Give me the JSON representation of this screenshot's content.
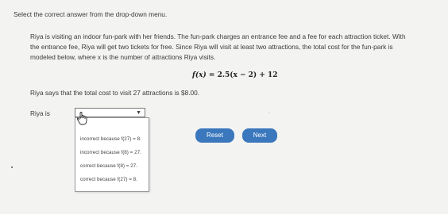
{
  "instruction": "Select the correct answer from the drop-down menu.",
  "problem": {
    "line1": "Riya is visiting an indoor fun-park with her friends. The fun-park charges an entrance fee and a fee for each attraction ticket. With",
    "line2": "the entrance fee, Riya will get two tickets for free. Since Riya will visit at least two attractions, the total cost for the fun-park is",
    "line3": "modeled below, where x is the number of attractions Riya visits."
  },
  "formula": {
    "lhs": "f(x)",
    "eq": " = ",
    "rhs": "2.5(x − 2) + 12"
  },
  "statement": "Riya says that the total cost to visit 27 attractions is $8.00.",
  "answer": {
    "prefix": "Riya is",
    "selected": "",
    "options": [
      "incorrect because f(27) = 8.",
      "incorrect because f(8) = 27.",
      "correct because f(8) = 27.",
      "correct because f(27) = 8."
    ]
  },
  "buttons": {
    "reset": "Reset",
    "next": "Next"
  },
  "colors": {
    "button": "#3a77bd",
    "background": "#f3f3f1"
  }
}
